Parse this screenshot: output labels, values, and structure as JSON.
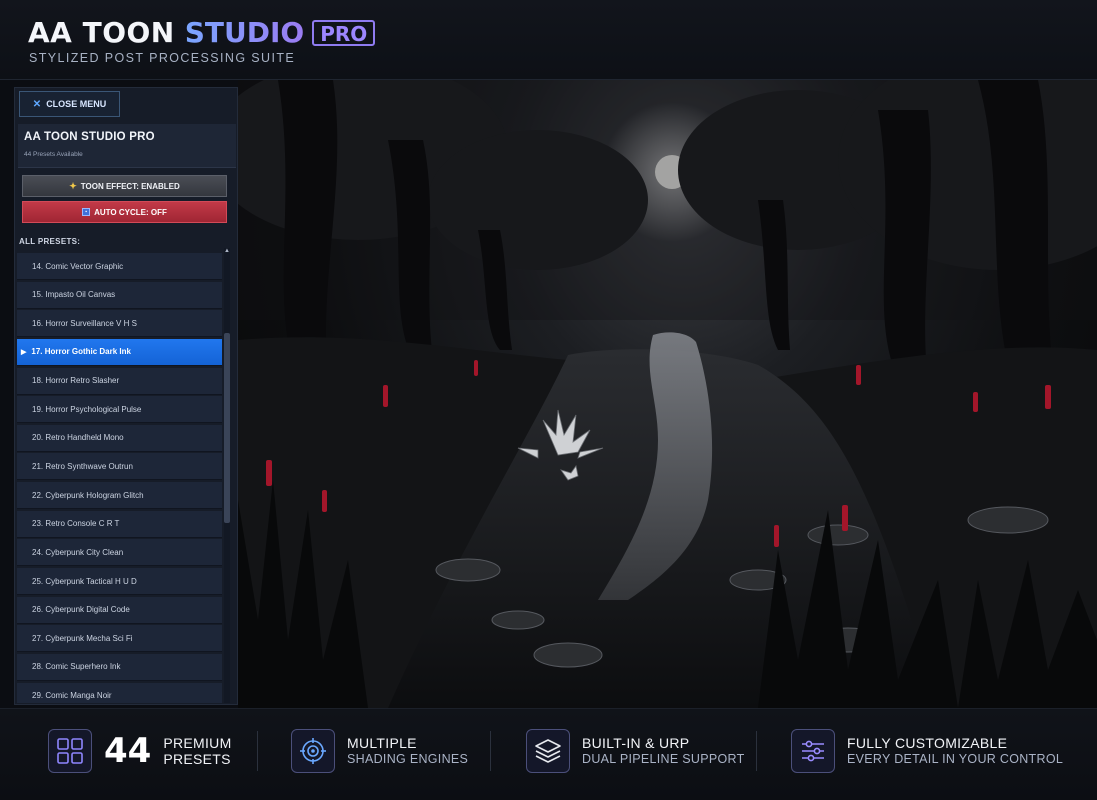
{
  "header": {
    "brand_white": "AA TOON",
    "brand_gradient": "STUDIO",
    "brand_badge": "PRO",
    "tagline": "STYLIZED POST PROCESSING SUITE"
  },
  "sidebar": {
    "close_label": "CLOSE MENU",
    "close_icon": "close-icon",
    "title": "AA TOON STUDIO PRO",
    "subtitle": "44 Presets Available",
    "toon_button": "TOON EFFECT: ENABLED",
    "toon_icon": "sparkle-icon",
    "cycle_button": "AUTO CYCLE: OFF",
    "cycle_icon": "cycle-icon",
    "presets_label": "ALL PRESETS:",
    "presets": [
      "14. Comic Vector Graphic",
      "15. Impasto Oil Canvas",
      "16. Horror Surveillance V H S",
      "17. Horror Gothic Dark Ink",
      "18. Horror Retro Slasher",
      "19. Horror Psychological Pulse",
      "20. Retro Handheld Mono",
      "21. Retro Synthwave Outrun",
      "22. Cyberpunk Hologram Glitch",
      "23. Retro Console C R T",
      "24. Cyberpunk City Clean",
      "25. Cyberpunk Tactical H U D",
      "26. Cyberpunk Digital Code",
      "27. Cyberpunk Mecha Sci Fi",
      "28. Comic Superhero Ink",
      "29. Comic Manga Noir"
    ],
    "active_preset": "17. Horror Gothic Dark Ink"
  },
  "footer": {
    "f1_number": "44",
    "f1_line1": "PREMIUM",
    "f1_line2": "PRESETS",
    "f2_line1": "MULTIPLE",
    "f2_line2": "SHADING ENGINES",
    "f3_line1": "BUILT-IN & URP",
    "f3_line2": "DUAL PIPELINE SUPPORT",
    "f4_line1": "FULLY CUSTOMIZABLE",
    "f4_line2": "EVERY DETAIL IN YOUR CONTROL"
  },
  "colors": {
    "accent_blue": "#1a6ee6",
    "accent_red": "#b22e3c",
    "accent_purple": "#9b7cf2"
  }
}
